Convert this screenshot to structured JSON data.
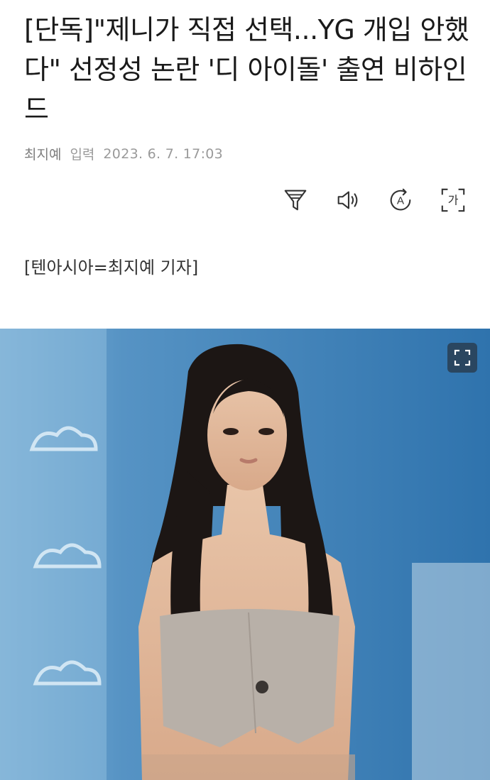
{
  "article": {
    "headline": "[단독]\"제니가 직접 선택...YG 개입 안했다\" 선정성 논란 '디 아이돌' 출연 비하인드",
    "author": "최지예",
    "date_label": "입력",
    "date": "2023. 6. 7. 17:03",
    "credit": "[텐아시아=최지예 기자]"
  },
  "toolbar": {
    "icons": [
      "filter-icon",
      "speaker-icon",
      "translate-icon",
      "font-size-icon"
    ],
    "font_size_glyph": "가",
    "translate_glyph": "A"
  },
  "photo": {
    "background_color": "#4a86b3",
    "has_expand_button": true
  }
}
